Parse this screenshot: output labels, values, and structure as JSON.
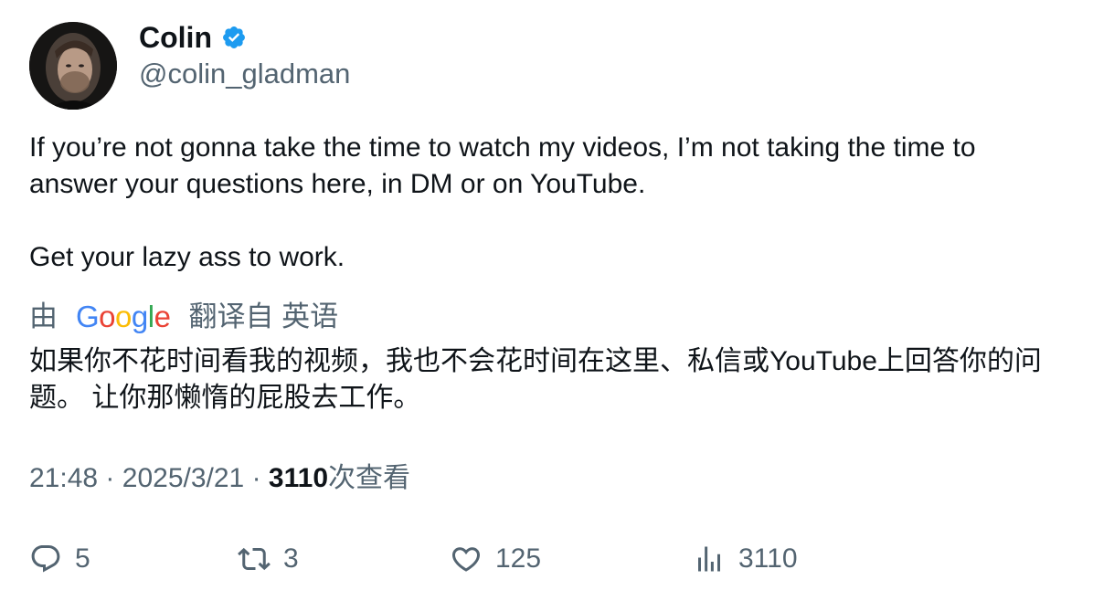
{
  "user": {
    "display_name": "Colin",
    "handle": "@colin_gladman",
    "verified": true,
    "verified_color": "#1d9bf0"
  },
  "tweet": {
    "paragraphs": [
      "If you’re not gonna take the time to watch my videos, I’m not taking the time to answer your questions here, in DM or on YouTube.",
      "Get your lazy ass to work."
    ]
  },
  "translation": {
    "prefix": "由",
    "provider_logo": "Google",
    "suffix": "翻译自 英语",
    "text": "如果你不花时间看我的视频，我也不会花时间在这里、私信或YouTube上回答你的问题。 让你那懒惰的屁股去工作。"
  },
  "meta": {
    "time": "21:48",
    "separator": "·",
    "date": "2025/3/21",
    "views_count": "3110",
    "views_label": "次查看"
  },
  "actions": {
    "replies": "5",
    "retweets": "3",
    "likes": "125",
    "views": "3110"
  },
  "colors": {
    "text": "#0f1419",
    "secondary": "#536471",
    "google_blue": "#4285f4",
    "google_red": "#ea4335",
    "google_yellow": "#fbbc05",
    "google_green": "#34a853"
  }
}
